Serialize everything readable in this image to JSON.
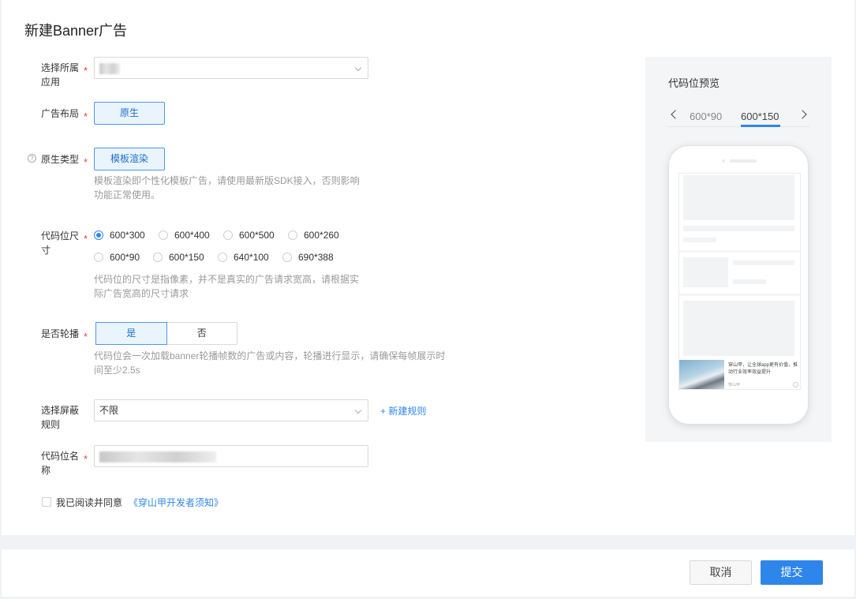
{
  "page": {
    "title": "新建Banner广告"
  },
  "form": {
    "app": {
      "label": "选择所属应用",
      "required": "*"
    },
    "layout": {
      "label": "广告布局",
      "required": "*",
      "value": "原生"
    },
    "native_type": {
      "label": "原生类型",
      "required": "*",
      "value": "模板渲染",
      "help": "模板渲染即个性化模板广告，请使用最新版SDK接入，否则影响功能正常使用。"
    },
    "size": {
      "label": "代码位尺寸",
      "required": "*",
      "options": [
        "600*300",
        "600*400",
        "600*500",
        "600*260",
        "600*90",
        "600*150",
        "640*100",
        "690*388"
      ],
      "selected": "600*300",
      "help": "代码位的尺寸是指像素，并不是真实的广告请求宽高，请根据实际广告宽高的尺寸请求"
    },
    "carousel": {
      "label": "是否轮播",
      "required": "*",
      "yes": "是",
      "no": "否",
      "selected": "是",
      "help": "代码位会一次加载banner轮播帧数的广告或内容，轮播进行显示，请确保每帧展示时间至少2.5s"
    },
    "block_rule": {
      "label": "选择屏蔽规则",
      "value": "不限",
      "new_rule_link": "+ 新建规则"
    },
    "slot_name": {
      "label": "代码位名称",
      "required": "*"
    },
    "agreement": {
      "text": "我已阅读并同意",
      "link": "《穿山甲开发者须知》"
    }
  },
  "preview": {
    "title": "代码位预览",
    "tabs": [
      "600*90",
      "600*150"
    ],
    "active_tab": "600*150",
    "ad_text": "穿山甲，让全球app更有价值，推动行业效率效益提升",
    "ad_source": "穿山甲"
  },
  "footer": {
    "cancel": "取消",
    "submit": "提交"
  },
  "colors": {
    "accent": "#2f86ea",
    "required": "#e8453c"
  }
}
